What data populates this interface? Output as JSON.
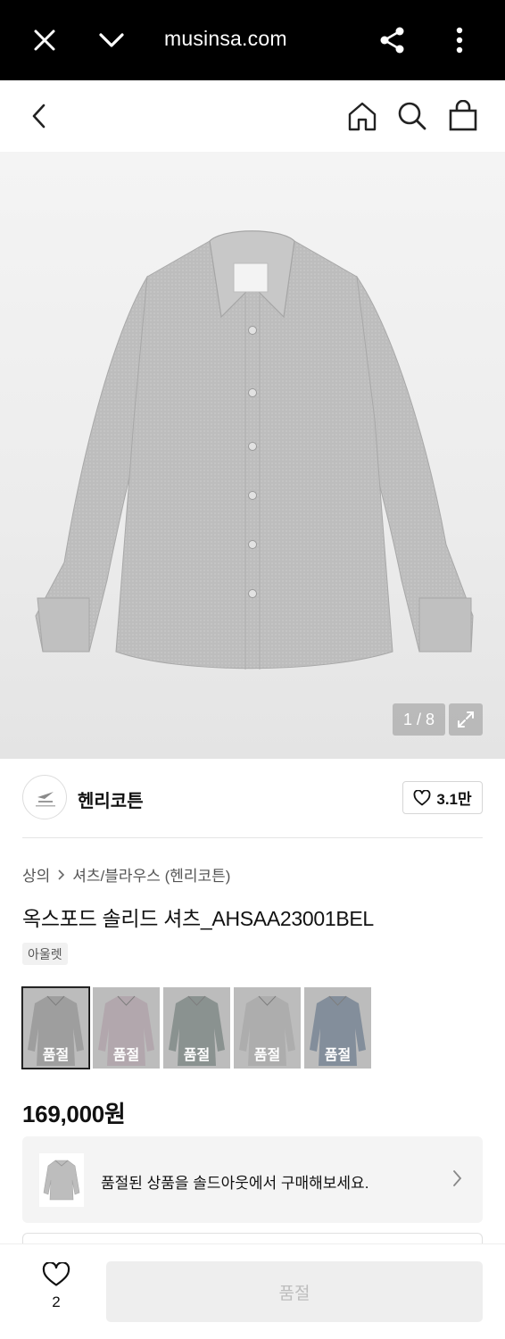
{
  "browser": {
    "url": "musinsa.com",
    "close_icon": "close-icon",
    "menu_icon": "chevron-down-icon",
    "share_icon": "share-icon",
    "more_icon": "more-vertical-icon"
  },
  "header": {
    "back_icon": "back-icon",
    "home_icon": "home-icon",
    "search_icon": "search-icon",
    "cart_icon": "shopping-bag-icon"
  },
  "gallery": {
    "counter": "1 / 8",
    "expand_icon": "expand-icon"
  },
  "brand": {
    "name": "헨리코튼",
    "likes": "3.1만"
  },
  "breadcrumb": {
    "category": "상의",
    "subcategory": "셔츠/블라우스 (헨리코튼)"
  },
  "product": {
    "title": "옥스포드 솔리드 셔츠_AHSAA23001BEL",
    "badge": "아울렛",
    "price": "169,000원"
  },
  "colors": [
    {
      "label": "품절",
      "tint": "#b9b9b9",
      "selected": true
    },
    {
      "label": "품절",
      "tint": "#d8c7cf",
      "selected": false
    },
    {
      "label": "품절",
      "tint": "#9aa6a3",
      "selected": false
    },
    {
      "label": "품절",
      "tint": "#cfcfcf",
      "selected": false
    },
    {
      "label": "품절",
      "tint": "#8fa0b4",
      "selected": false
    }
  ],
  "soldout_banner": {
    "message": "품절된 상품을 솔드아웃에서 구매해보세요."
  },
  "bottom": {
    "wish_count": "2",
    "buy_label": "품절"
  }
}
